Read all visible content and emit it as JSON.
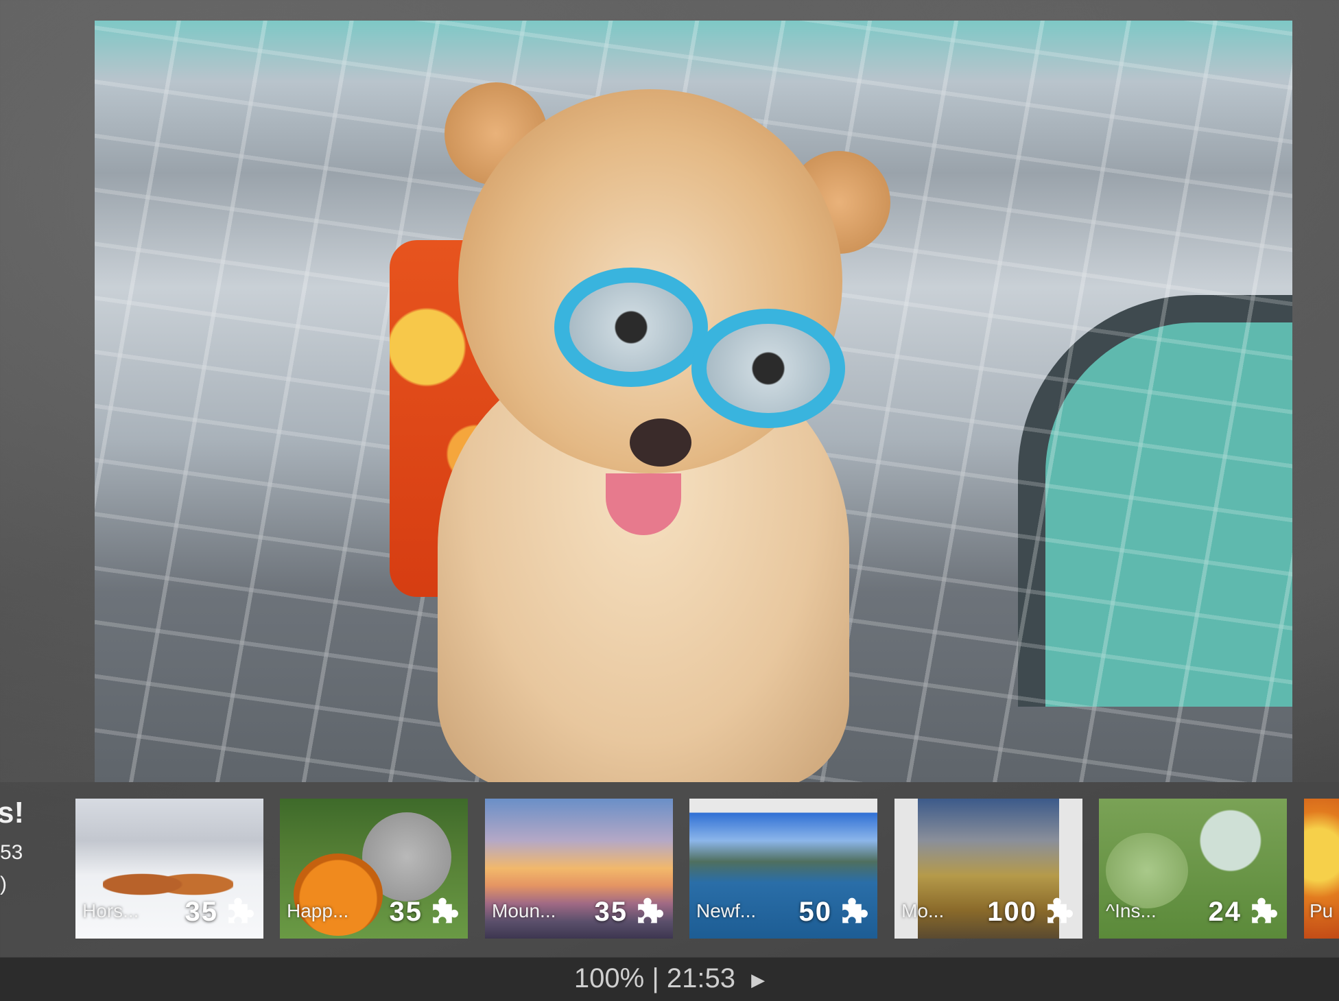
{
  "side_info": {
    "line1": "s!",
    "line2": "53",
    "line3": ")"
  },
  "thumbnails": [
    {
      "name": "Hors...",
      "count": "35",
      "image": "horses-in-snow"
    },
    {
      "name": "Happ...",
      "count": "35",
      "image": "koalas-with-pumpkin"
    },
    {
      "name": "Moun...",
      "count": "35",
      "image": "mountain-sunset"
    },
    {
      "name": "Newf...",
      "count": "50",
      "image": "coastal-house"
    },
    {
      "name": "Mo...",
      "count": "100",
      "image": "railway-tracks"
    },
    {
      "name": "^Ins...",
      "count": "24",
      "image": "insect-on-plant"
    },
    {
      "name": "Pu",
      "count": "",
      "image": "flowers"
    }
  ],
  "status": {
    "zoom": "100%",
    "separator": "|",
    "time": "21:53",
    "play_icon": "play-icon"
  },
  "main_image": "pomeranian-with-goggles"
}
